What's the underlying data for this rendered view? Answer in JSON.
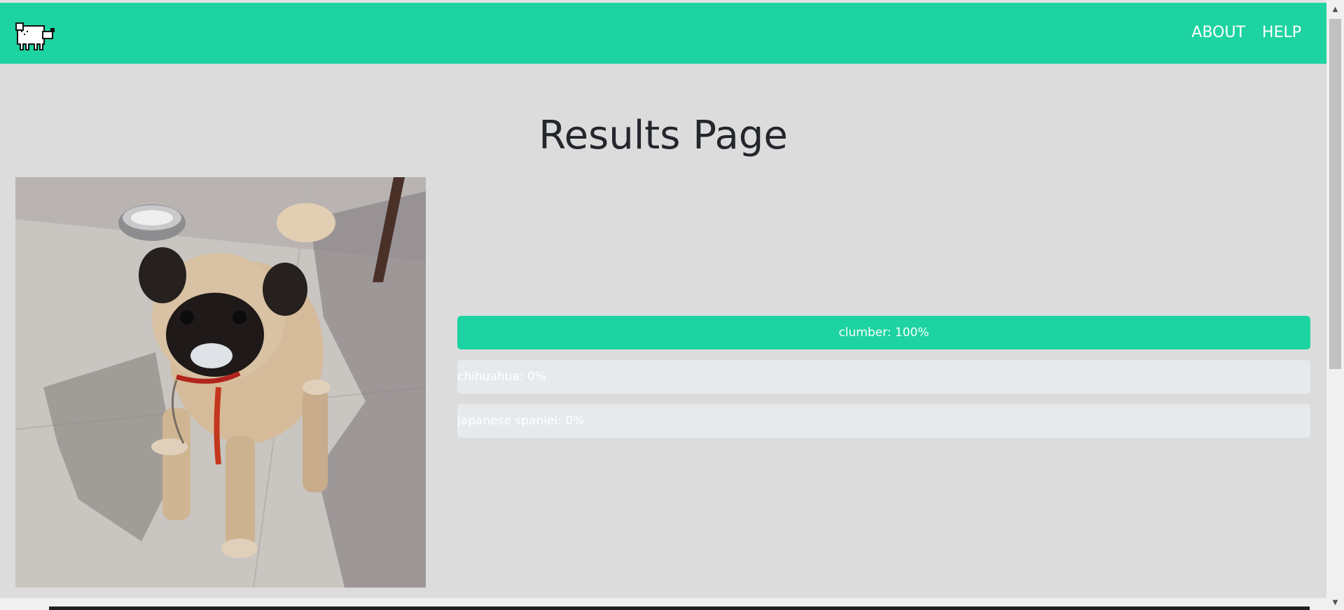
{
  "navbar": {
    "logo_icon": "pixel-dog-icon",
    "color": "#1dd3a1",
    "links": [
      {
        "label": "ABOUT"
      },
      {
        "label": "HELP"
      }
    ]
  },
  "page": {
    "title": "Results Page"
  },
  "image": {
    "subject": "pug-photo"
  },
  "results": [
    {
      "label": "clumber: 100%",
      "fraction": 1.0
    },
    {
      "label": "chihuahua: 0%",
      "fraction": 0.0
    },
    {
      "label": "japanese spaniel: 0%",
      "fraction": 0.0
    }
  ],
  "colors": {
    "accent": "#1dd3a1",
    "background": "#dcdcdc",
    "track": "#e7eaec",
    "title": "#23262b"
  }
}
